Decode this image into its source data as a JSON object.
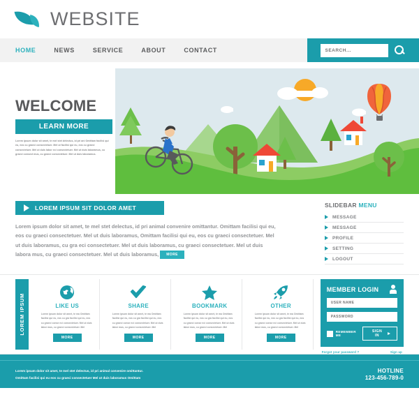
{
  "header": {
    "brand": "WEBSITE",
    "logo_icon": "leaf-logo",
    "accent": "#1b9dab",
    "accent_light": "#2cb1bd"
  },
  "nav": {
    "items": [
      {
        "label": "HOME",
        "active": true
      },
      {
        "label": "NEWS",
        "active": false
      },
      {
        "label": "SERVICE",
        "active": false
      },
      {
        "label": "ABOUT",
        "active": false
      },
      {
        "label": "CONTACT",
        "active": false
      }
    ],
    "search": {
      "placeholder": "SEARCH...",
      "value": "",
      "icon": "search-icon"
    }
  },
  "hero": {
    "title": "WELCOME",
    "cta": "LEARN MORE",
    "text": "Lorem ipsum dolor sit amet, te mel stet delectus, id pri ani Omittam facilisi qui eu, eos cu graeci consectetuer. Mel ut facilisi qui eu, eos cu graeci consectetuer. Mel ut duis labor eci consectetuer. Mel ut duis laboramus,  cu graeci consect mus, cu graeci consectetuer. Mel ut duis laboramus.",
    "illustration": "landscape-cyclist-scene"
  },
  "content": {
    "section_title": "LOREM IPSUM SIT DOLOR AMET",
    "body": "Lorem ipsum dolor sit amet, te mel stet delectus, id pri animal convenire omittantur. Omittam facilisi qui eu, eos cu graeci consectetuer. Mel ut duis laboramus, Omittam facilisi qui eu, eos cu graeci consectetuer. Mel ut duis laboramus,  cu gra eci consectetuer. Mel ut duis laboramus,  cu graeci consectetuer. Mel ut duis labora mus, cu graeci consectetuer. Mel ut duis laboramus, ",
    "more_label": "MORE"
  },
  "slidebar": {
    "title_main": "SLIDEBAR ",
    "title_accent": "MENU",
    "items": [
      {
        "label": "MESSAGE"
      },
      {
        "label": "MESSAGE"
      },
      {
        "label": "PROFILE"
      },
      {
        "label": "SETTING"
      },
      {
        "label": "LOGOUT"
      }
    ]
  },
  "features": {
    "vertical_tab": "LOREM IPSUM",
    "card_text": "Lorem ipsum dolor sit amet, te ma Omittam facilisi qui eu, eos cu gra facilisi qui eu, eos cu graeci conse eci consectetuer. Mel ut duis labor mus,  cu graeci consectetuer. Mel",
    "more_label": "MORE",
    "cards": [
      {
        "title": "LIKE US",
        "icon": "globe-icon"
      },
      {
        "title": "SHARE",
        "icon": "check-icon"
      },
      {
        "title": "BOOKMARK",
        "icon": "star-icon"
      },
      {
        "title": "OTHER",
        "icon": "rocket-icon"
      }
    ]
  },
  "login": {
    "title": "MEMBER LOGIN",
    "avatar_icon": "user-icon",
    "username_placeholder": "USER NAME",
    "username_value": "",
    "password_placeholder": "PASSWORD",
    "password_value": "",
    "remember_label": "REMEMBER ME",
    "remember_checked": false,
    "signin_label": "SIGN IN",
    "forgot_label": "Forgot your password ?",
    "signup_label": "Sign up"
  },
  "footer": {
    "text_line1": "Lorem ipsum dolor sit amet, te mel stet delectus, id pri animal convenire omittantur.",
    "text_line2": "Omittam facilisi qui eu  eos cu graeci consectetuer  Mel ut duis laboramus  Omittam",
    "hotline_label": "HOTLINE",
    "hotline_number": "123-456-789-0"
  }
}
